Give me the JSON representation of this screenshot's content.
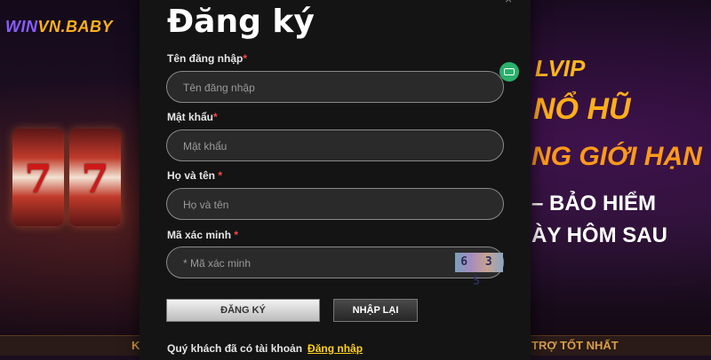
{
  "brand": {
    "logo_win": "WIN",
    "logo_rest": "VN.BABY"
  },
  "background": {
    "promo_lines": [
      "LVIP",
      "NỔ HŨ",
      "NG GIỚI HẠN",
      "– BẢO HIỂM",
      "ÀY HÔM SAU"
    ],
    "reel_symbol": "7",
    "strip_left": "K",
    "strip_right": "TRỢ TỐT NHẤT"
  },
  "modal": {
    "close_glyph": "×",
    "title": "Đăng ký",
    "fields": {
      "username": {
        "label": "Tên đăng nhập",
        "required_mark": "*",
        "placeholder": "Tên đăng nhập",
        "value": ""
      },
      "password": {
        "label": "Mật khẩu",
        "required_mark": "*",
        "placeholder": "Mật khẩu",
        "value": ""
      },
      "fullname": {
        "label": "Họ và tên",
        "required_mark": "*",
        "placeholder": "Họ và tên",
        "value": ""
      },
      "captcha": {
        "label": "Mã xác minh",
        "required_mark": "*",
        "placeholder": "* Mã xác minh",
        "value": "",
        "image_text": "6 3 5"
      }
    },
    "buttons": {
      "register": "ĐĂNG KÝ",
      "reset": "NHẬP LẠI"
    },
    "footer": {
      "prompt": "Quý khách đã có tài khoản",
      "login_link": "Đăng nhập"
    }
  },
  "colors": {
    "accent_gold": "#ffd21a",
    "required_red": "#ff4a4a",
    "modal_bg": "#141414"
  },
  "icons": {
    "side_icon": "chat-bot-icon"
  }
}
